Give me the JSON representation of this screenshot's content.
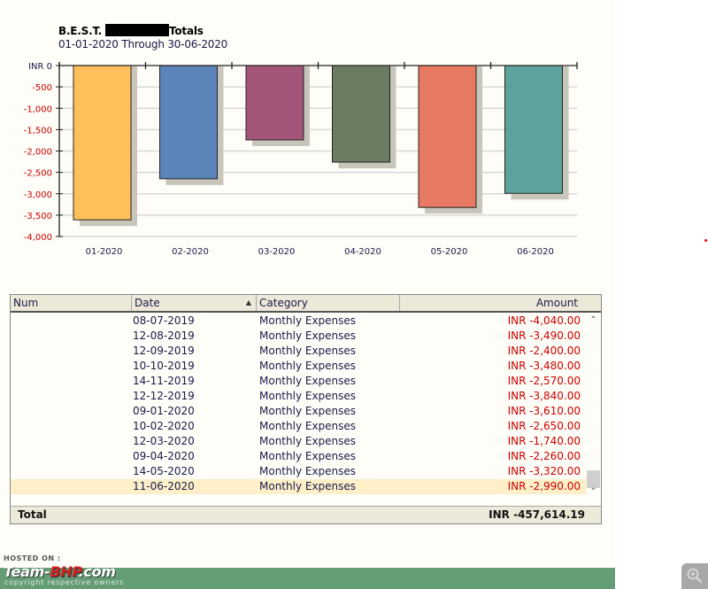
{
  "report": {
    "title_prefix": "B.E.S.T.",
    "title_suffix": "Totals",
    "subtitle": "01-01-2020 Through 30-06-2020"
  },
  "chart_data": {
    "type": "bar",
    "title": "B.E.S.T. [redacted] Totals",
    "subtitle": "01-01-2020 Through 30-06-2020",
    "xlabel": "",
    "ylabel": "INR",
    "categories": [
      "01-2020",
      "02-2020",
      "03-2020",
      "04-2020",
      "05-2020",
      "06-2020"
    ],
    "values": [
      -3610,
      -2650,
      -1740,
      -2260,
      -3320,
      -2990
    ],
    "colors": [
      "#ffc05c",
      "#5b84b8",
      "#a35679",
      "#6b7c62",
      "#e87a64",
      "#5ba39c"
    ],
    "ylim": [
      -4000,
      0
    ],
    "yticks": [
      0,
      -500,
      -1000,
      -1500,
      -2000,
      -2500,
      -3000,
      -3500,
      -4000
    ],
    "ytick_labels": [
      "INR 0",
      "-500",
      "-1,000",
      "-1,500",
      "-2,000",
      "-2,500",
      "-3,000",
      "-3,500",
      "-4,000"
    ],
    "grid": true,
    "legend": "none"
  },
  "table": {
    "columns": [
      "Num",
      "Date",
      "Category",
      "Amount"
    ],
    "sort_column": "Date",
    "sort_direction": "ascending",
    "rows": [
      {
        "num": "",
        "date": "08-07-2019",
        "category": "Monthly Expenses",
        "amount": "INR -4,040.00"
      },
      {
        "num": "",
        "date": "12-08-2019",
        "category": "Monthly Expenses",
        "amount": "INR -3,490.00"
      },
      {
        "num": "",
        "date": "12-09-2019",
        "category": "Monthly Expenses",
        "amount": "INR -2,400.00"
      },
      {
        "num": "",
        "date": "10-10-2019",
        "category": "Monthly Expenses",
        "amount": "INR -3,480.00"
      },
      {
        "num": "",
        "date": "14-11-2019",
        "category": "Monthly Expenses",
        "amount": "INR -2,570.00"
      },
      {
        "num": "",
        "date": "12-12-2019",
        "category": "Monthly Expenses",
        "amount": "INR -3,840.00"
      },
      {
        "num": "",
        "date": "09-01-2020",
        "category": "Monthly Expenses",
        "amount": "INR -3,610.00"
      },
      {
        "num": "",
        "date": "10-02-2020",
        "category": "Monthly Expenses",
        "amount": "INR -2,650.00"
      },
      {
        "num": "",
        "date": "12-03-2020",
        "category": "Monthly Expenses",
        "amount": "INR -1,740.00"
      },
      {
        "num": "",
        "date": "09-04-2020",
        "category": "Monthly Expenses",
        "amount": "INR -2,260.00"
      },
      {
        "num": "",
        "date": "14-05-2020",
        "category": "Monthly Expenses",
        "amount": "INR -3,320.00"
      },
      {
        "num": "",
        "date": "11-06-2020",
        "category": "Monthly Expenses",
        "amount": "INR -2,990.00"
      }
    ],
    "selected_row": 11,
    "footer_label": "Total",
    "footer_total": "INR -457,614.19"
  },
  "watermark": {
    "hosted_on": "HOSTED ON :",
    "brand_a": "Team-",
    "brand_b": "BHP",
    "brand_c": ".com",
    "copyright": "copyright respective owners"
  },
  "icons": {
    "sort": "sort-ascending-icon",
    "scroll_up": "chevron-up-icon",
    "scroll_down": "chevron-down-icon",
    "zoom": "zoom-in-icon"
  }
}
